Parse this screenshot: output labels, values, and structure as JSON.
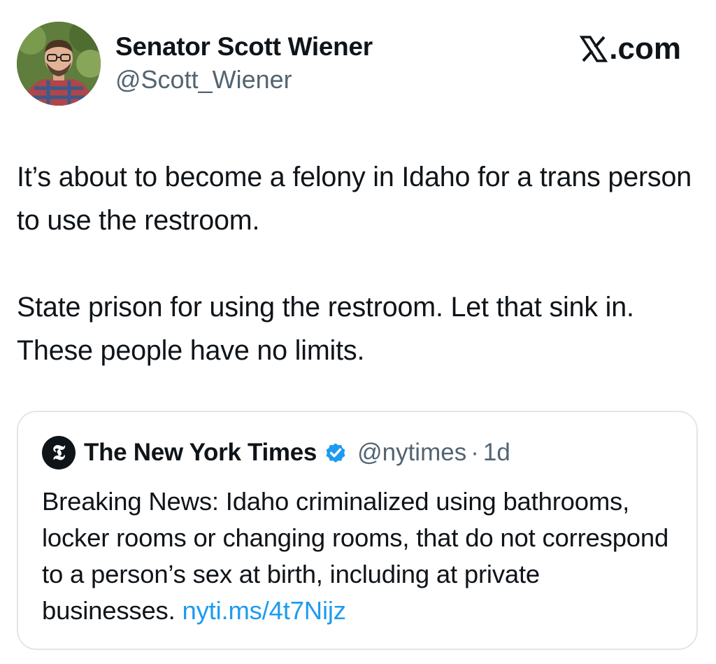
{
  "author": {
    "name": "Senator Scott Wiener",
    "handle": "@Scott_Wiener"
  },
  "source": {
    "label": ".com",
    "icon": "x-logo-icon"
  },
  "tweet": {
    "paragraph_1": "It’s about to become a felony in Idaho for a trans person to use the restroom.",
    "paragraph_2": "State prison for using the restroom. Let that sink in. These people have no limits."
  },
  "quoted_tweet": {
    "author_name": "The New York Times",
    "handle": "@nytimes",
    "separator": "·",
    "time": "1d",
    "logo_icon": "nyt-logo-icon",
    "verified_icon": "verified-badge-icon",
    "text": "Breaking News: Idaho criminalized using bathrooms, locker rooms or changing rooms, that do not correspond to a person’s sex at birth, including at private businesses.",
    "link": "nyti.ms/4t7Nijz"
  },
  "colors": {
    "text_primary": "#0f1419",
    "text_secondary": "#536471",
    "link": "#1d9bf0",
    "verified": "#1d9bf0",
    "border": "#e1e6ea"
  }
}
